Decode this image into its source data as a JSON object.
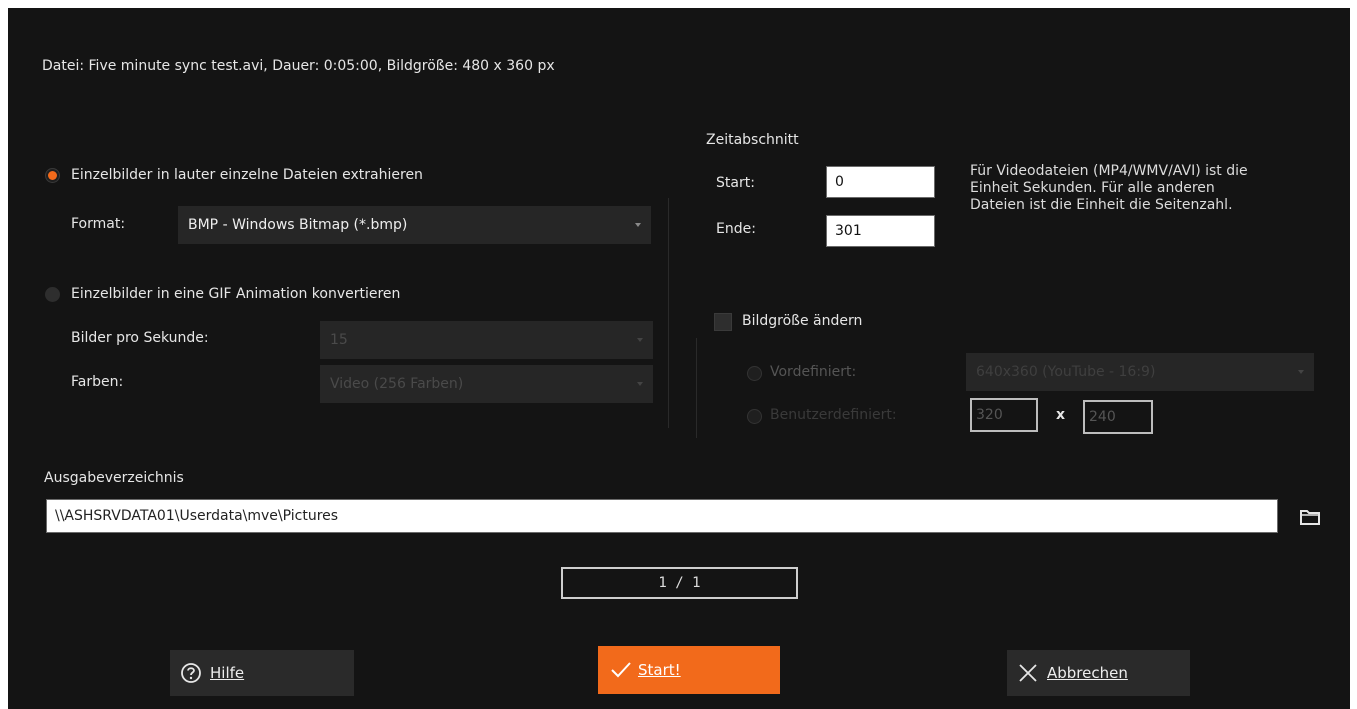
{
  "file_info": "Datei: Five minute sync test.avi, Dauer: 0:05:00, Bildgröße: 480 x 360 px",
  "extract_option": {
    "label": "Einzelbilder in lauter einzelne Dateien extrahieren",
    "selected": true,
    "format_label": "Format:",
    "format_value": "BMP - Windows Bitmap (*.bmp)"
  },
  "gif_option": {
    "label": "Einzelbilder in eine GIF Animation konvertieren",
    "selected": false,
    "fps_label": "Bilder pro Sekunde:",
    "fps_value": "15",
    "colors_label": "Farben:",
    "colors_value": "Video (256 Farben)"
  },
  "time_range": {
    "title": "Zeitabschnitt",
    "start_label": "Start:",
    "start_value": "0",
    "end_label": "Ende:",
    "end_value": "301",
    "info": "Für Videodateien (MP4/WMV/AVI) ist die\nEinheit Sekunden. Für alle anderen\nDateien ist die Einheit die Seitenzahl."
  },
  "resize": {
    "label": "Bildgröße ändern",
    "checked": false,
    "predefined_label": "Vordefiniert:",
    "predefined_value": "640x360 (YouTube - 16:9)",
    "custom_label": "Benutzerdefiniert:",
    "width_value": "320",
    "x_label": "x",
    "height_value": "240"
  },
  "output": {
    "label": "Ausgabeverzeichnis",
    "path": "\\\\ASHSRVDATA01\\Userdata\\mve\\Pictures",
    "folder_icon": "folder-icon"
  },
  "progress": {
    "text": "1 / 1"
  },
  "buttons": {
    "help": "Hilfe",
    "start": "Start!",
    "cancel": "Abbrechen"
  },
  "colors": {
    "accent": "#f26a1b",
    "background": "#141414"
  }
}
